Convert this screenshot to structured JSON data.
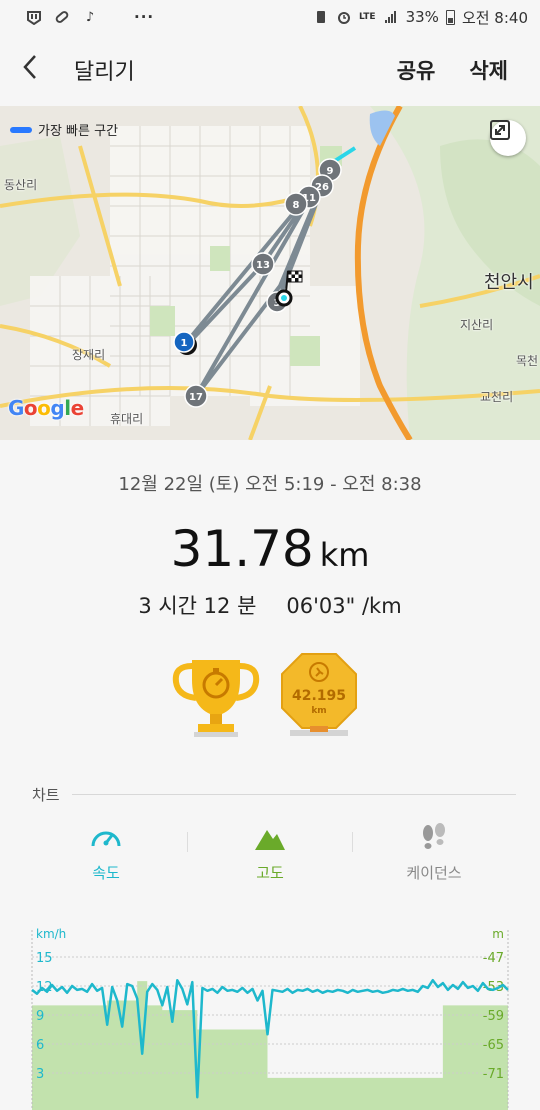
{
  "status_bar": {
    "battery": "33%",
    "time": "오전 8:40",
    "network": "LTE"
  },
  "appbar": {
    "title": "달리기",
    "share_label": "공유",
    "delete_label": "삭제"
  },
  "map": {
    "legend_label": "가장 빠른 구간",
    "google_logo": "Google",
    "place_labels": [
      "동산리",
      "장재리",
      "휴대리",
      "천안시",
      "지산리",
      "교천리",
      "목천"
    ],
    "markers": [
      "1",
      "3",
      "8",
      "9",
      "11",
      "13",
      "17",
      "26"
    ]
  },
  "summary": {
    "date_range": "12월 22일 (토) 오전 5:19 - 오전 8:38",
    "distance_value": "31.78",
    "distance_unit": "km",
    "duration": "3 시간 12 분",
    "pace": "06'03\" /km"
  },
  "medals": {
    "badge_value": "42.195",
    "badge_unit": "km"
  },
  "chart_section": {
    "title": "차트",
    "tabs": [
      {
        "label": "속도",
        "icon": "speedometer-icon",
        "color": "#1eb8cc"
      },
      {
        "label": "고도",
        "icon": "mountain-icon",
        "color": "#6aaa2a"
      },
      {
        "label": "케이던스",
        "icon": "footsteps-icon",
        "color": "#888888"
      }
    ]
  },
  "chart_data": {
    "type": "line",
    "left_axis": {
      "unit": "km/h",
      "ticks": [
        "15",
        "12",
        "9",
        "6",
        "3"
      ],
      "range": [
        0,
        15
      ]
    },
    "right_axis": {
      "unit": "m",
      "ticks": [
        "-47",
        "-53",
        "-59",
        "-65",
        "-71"
      ],
      "range": [
        -74,
        -47
      ]
    },
    "series": [
      {
        "color": "#1eb8cc",
        "values": [
          11.6,
          11.2,
          11.8,
          11.4,
          12.1,
          11.5,
          11.9,
          11.3,
          12.0,
          11.6,
          11.7,
          11.4,
          12.2,
          11.5,
          11.8,
          8.0,
          11.9,
          10.5,
          7.8,
          12.2,
          12.0,
          10.7,
          5.0,
          11.4,
          12.2,
          11.6,
          10.0,
          11.9,
          8.3,
          12.6,
          11.7,
          10.1,
          12.4,
          0.5,
          11.8,
          11.5,
          11.7,
          11.3,
          11.9,
          11.5,
          11.6,
          11.4,
          11.8,
          11.3,
          11.7,
          10.5,
          11.5,
          7.0,
          11.6,
          11.5,
          11.4,
          11.7,
          11.3,
          11.6,
          11.5,
          11.7,
          11.4,
          11.6,
          11.3,
          11.5,
          11.4,
          11.6,
          11.5,
          11.3,
          11.6,
          11.4,
          11.5,
          11.6,
          11.4,
          11.5,
          11.3,
          11.4,
          11.6,
          11.5,
          11.7,
          11.5,
          11.6,
          11.4,
          12.0,
          11.8,
          12.6,
          11.9,
          12.3,
          11.6,
          12.1,
          11.7,
          12.4,
          11.8,
          12.0,
          11.5,
          12.3,
          11.7,
          11.6,
          11.8,
          12.1,
          11.6
        ],
        "name": ""
      },
      {
        "color": "#b9dea0",
        "values": [
          -57,
          -57,
          -57,
          -57,
          -57,
          -57,
          -57,
          -57,
          -57,
          -57,
          -57,
          -57,
          -57,
          -57,
          -57,
          -56,
          -56,
          -56,
          -56,
          -56,
          -56,
          -52,
          -52,
          -57,
          -57,
          -57,
          -58,
          -58,
          -58,
          -58,
          -58,
          -58,
          -58,
          -62,
          -62,
          -62,
          -62,
          -62,
          -62,
          -62,
          -62,
          -62,
          -62,
          -62,
          -62,
          -62,
          -62,
          -72,
          -72,
          -72,
          -72,
          -72,
          -72,
          -72,
          -72,
          -72,
          -72,
          -72,
          -72,
          -72,
          -72,
          -72,
          -72,
          -72,
          -72,
          -72,
          -72,
          -72,
          -72,
          -72,
          -72,
          -72,
          -72,
          -72,
          -72,
          -72,
          -72,
          -72,
          -72,
          -72,
          -72,
          -72,
          -57,
          -57,
          -57,
          -57,
          -57,
          -57,
          -57,
          -57,
          -57,
          -57,
          -57,
          -57,
          -57,
          -57
        ],
        "name": ""
      }
    ]
  }
}
